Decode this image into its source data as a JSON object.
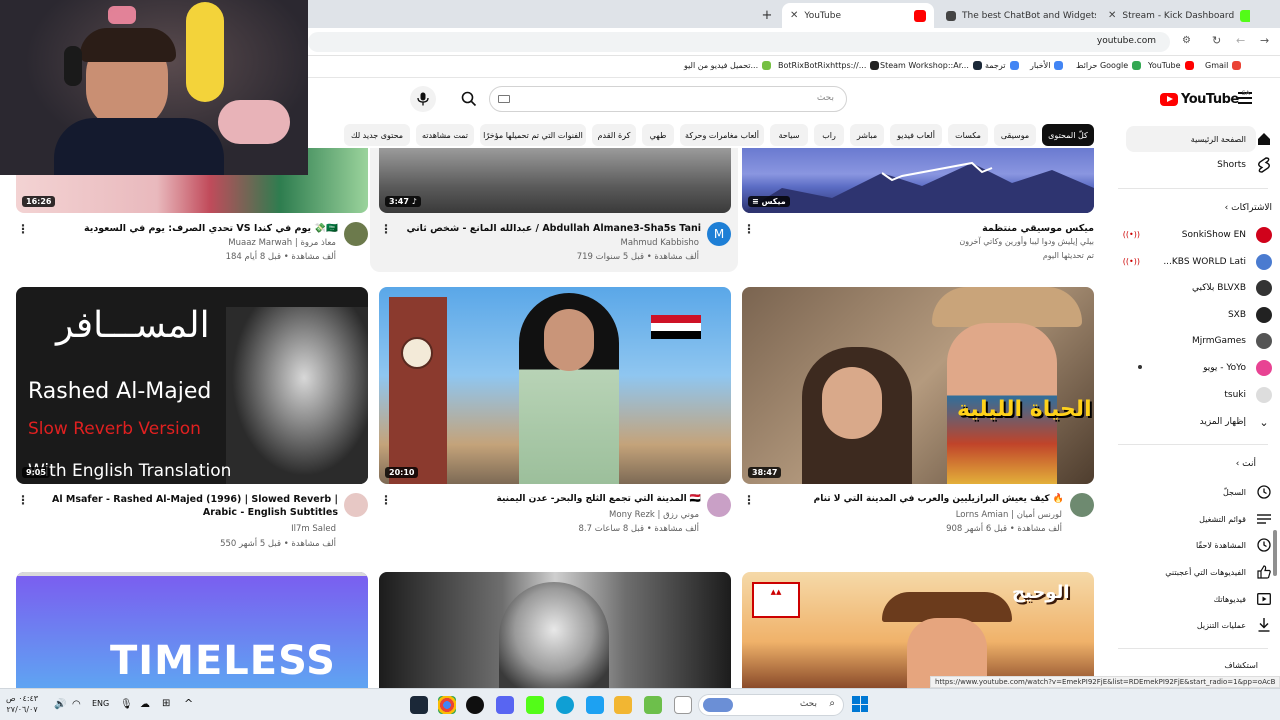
{
  "browser": {
    "tabs": [
      {
        "title": "YouTube",
        "active": true
      },
      {
        "title": "The best ChatBot and Widgets"
      },
      {
        "title": "Stream - Kick Dashboard"
      }
    ],
    "url": "youtube.com",
    "bookmarks": [
      "Gmail",
      "YouTube",
      "حرائط Google",
      "الأخبار",
      "ترجمة",
      "Steam Workshop::Ar...",
      "BotRixBotRixhttps://...",
      "تحميل فيديو من اليو..."
    ],
    "status_url": "https://www.youtube.com/watch?v=EmekPI92FjE&list=RDEmekPI92FjE&start_radio=1&pp=oAcB"
  },
  "youtube": {
    "logo": "YouTube",
    "logo_region": "SA",
    "search_placeholder": "بحث",
    "chips": [
      {
        "label": "كلّ المحتوى",
        "selected": true
      },
      {
        "label": "موسيقى"
      },
      {
        "label": "مكسات"
      },
      {
        "label": "ألعاب فيديو"
      },
      {
        "label": "مباشر"
      },
      {
        "label": "راب"
      },
      {
        "label": "سياحة"
      },
      {
        "label": "ألعاب مغامرات وحركة"
      },
      {
        "label": "طهي"
      },
      {
        "label": "كرة القدم"
      },
      {
        "label": "الفنوات التي تم تحميلها مؤخرًا"
      },
      {
        "label": "تمت مشاهدته"
      },
      {
        "label": "محتوى جديد لك"
      }
    ],
    "sidebar": {
      "home": "الصفحة الرئيسية",
      "shorts": "Shorts",
      "subscriptions_header": "الاشتراكات",
      "subscriptions": [
        {
          "name": "SonkiShow EN",
          "live": true,
          "color": "#d0021b"
        },
        {
          "name": "KBS WORLD Lati...",
          "live": true,
          "color": "#4a7bd0"
        },
        {
          "name": "BLVXB بلاكبي",
          "live": false,
          "color": "#333333"
        },
        {
          "name": "SXB",
          "live": false,
          "color": "#222222"
        },
        {
          "name": "MjrmGames",
          "live": false,
          "color": "#555555"
        },
        {
          "name": "YoYo - يويو",
          "live": false,
          "dot": true,
          "color": "#e84393"
        },
        {
          "name": "tsuki",
          "live": false,
          "color": "#777777"
        }
      ],
      "show_more": "إظهار المزيد",
      "you_header": "أنت",
      "you_items": [
        {
          "label": "السجلّ",
          "icon": "history-icon"
        },
        {
          "label": "قوائم التشغيل",
          "icon": "playlist-icon"
        },
        {
          "label": "المشاهدة لاحقًا",
          "icon": "clock-icon"
        },
        {
          "label": "الفيديوهات التي أعجبتني",
          "icon": "thumbs-up-icon"
        },
        {
          "label": "فيديوهاتك",
          "icon": "video-icon"
        },
        {
          "label": "عمليات التنزيل",
          "icon": "download-icon"
        }
      ],
      "explore_header": "استكشاف"
    },
    "videos": [
      {
        "title": "تحدي الصرف: يوم في السعودية VS يوم في كندا 💸🇸🇦",
        "channel": "Muaaz Marwah | معاذ مروة",
        "meta": "184 ألف مشاهدة • قبل 8 أيام",
        "duration": "16:26"
      },
      {
        "title": "عبدالله المانع - شخص ثاني / Abdullah Almane3-Sha5s Tani",
        "channel": "Mahmud Kabbisho",
        "meta": "719 ألف مشاهدة • قبل 5 سنوات",
        "duration": "3:47",
        "avatar_letter": "M"
      },
      {
        "title": "ميكس موسيقي منتظمة",
        "channel": "بيلي إيليش ودوا ليبا وأورين وكاتي آخرون",
        "meta": "تم تحديثها اليوم",
        "duration": "ميكس"
      },
      {
        "title": "Al Msafer - Rashed Al-Majed (1996) | Slowed Reverb | Arabic - English Subtitles",
        "channel": "Il7m Saled",
        "meta": "550 ألف مشاهدة • قبل 5 أشهر",
        "duration": "9:05",
        "thumb_text": [
          "المســـافر",
          "Rashed Al-Majed",
          "Slow Reverb Version",
          "With English Translation"
        ]
      },
      {
        "title": "المدينة التي تجمع الثلج والبحر- عدن اليمنية 🇾🇪",
        "channel": "Mony Rezk | موني رزق",
        "meta": "8.7 ألف مشاهدة • قبل 8 ساعات",
        "duration": "20:10"
      },
      {
        "title": "كيف يعيش البرازيليين والعرب في المدينة التي لا تنام 🔥",
        "channel": "Lorns Amian | لورنس أميان",
        "meta": "908 ألف مشاهدة • قبل 6 أشهر",
        "duration": "38:47",
        "thumb_text": [
          "الحياة الليلية"
        ]
      },
      {
        "title": "",
        "channel": "",
        "meta": "",
        "thumb_text": [
          "TIMELESS"
        ]
      },
      {
        "title": "",
        "channel": "",
        "meta": ""
      },
      {
        "title": "",
        "channel": "",
        "meta": "",
        "thumb_text": [
          "الوحيح"
        ]
      }
    ]
  },
  "taskbar": {
    "search": "بحث",
    "lang": "ENG",
    "time": "٠٤:٤٣ ص",
    "date": "٢٧/٠٦/٠٧"
  }
}
